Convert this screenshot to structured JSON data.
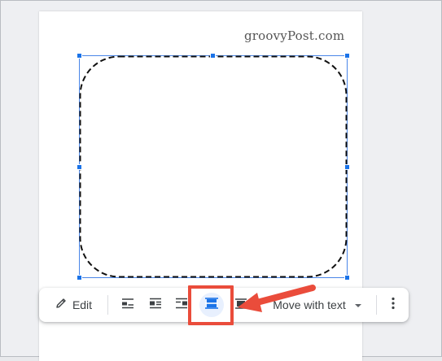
{
  "watermark": "groovyPost.com",
  "toolbar": {
    "edit_label": "Edit",
    "wrap_options": [
      {
        "icon": "wrap-inline-icon",
        "active": false
      },
      {
        "icon": "wrap-text-icon",
        "active": false
      },
      {
        "icon": "break-text-icon",
        "active": false
      },
      {
        "icon": "behind-text-icon",
        "active": true
      },
      {
        "icon": "in-front-of-text-icon",
        "active": false
      }
    ],
    "position_label": "Move with text",
    "more_icon": "more-vertical-icon"
  },
  "colors": {
    "accent": "#1a73e8",
    "active_bg": "#e8f0fe",
    "callout": "#ea4c3b"
  }
}
